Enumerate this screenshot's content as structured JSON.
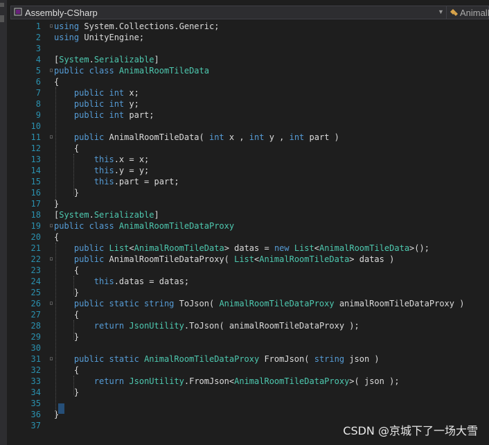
{
  "toolbar": {
    "project": "Assembly-CSharp",
    "member": "AnimalR"
  },
  "watermark": "CSDN @京城下了一场大雪",
  "lines": [
    [
      [
        "kw",
        "using"
      ],
      [
        "pl",
        " System.Collections.Generic;"
      ]
    ],
    [
      [
        "kw",
        "using"
      ],
      [
        "pl",
        " UnityEngine;"
      ]
    ],
    [],
    [
      [
        "pl",
        "["
      ],
      [
        "ty",
        "System"
      ],
      [
        "pl",
        "."
      ],
      [
        "ty",
        "Serializable"
      ],
      [
        "pl",
        "]"
      ]
    ],
    [
      [
        "kw",
        "public class "
      ],
      [
        "ty",
        "AnimalRoomTileData"
      ]
    ],
    [
      [
        "pl",
        "{"
      ]
    ],
    [
      [
        "pl",
        "    "
      ],
      [
        "kw",
        "public int"
      ],
      [
        "pl",
        " x;"
      ]
    ],
    [
      [
        "pl",
        "    "
      ],
      [
        "kw",
        "public int"
      ],
      [
        "pl",
        " y;"
      ]
    ],
    [
      [
        "pl",
        "    "
      ],
      [
        "kw",
        "public int"
      ],
      [
        "pl",
        " part;"
      ]
    ],
    [],
    [
      [
        "pl",
        "    "
      ],
      [
        "kw",
        "public"
      ],
      [
        "pl",
        " AnimalRoomTileData( "
      ],
      [
        "kw",
        "int"
      ],
      [
        "pl",
        " x , "
      ],
      [
        "kw",
        "int"
      ],
      [
        "pl",
        " y , "
      ],
      [
        "kw",
        "int"
      ],
      [
        "pl",
        " part )"
      ]
    ],
    [
      [
        "pl",
        "    {"
      ]
    ],
    [
      [
        "pl",
        "        "
      ],
      [
        "kw",
        "this"
      ],
      [
        "pl",
        ".x = x;"
      ]
    ],
    [
      [
        "pl",
        "        "
      ],
      [
        "kw",
        "this"
      ],
      [
        "pl",
        ".y = y;"
      ]
    ],
    [
      [
        "pl",
        "        "
      ],
      [
        "kw",
        "this"
      ],
      [
        "pl",
        ".part = part;"
      ]
    ],
    [
      [
        "pl",
        "    }"
      ]
    ],
    [
      [
        "pl",
        "}"
      ]
    ],
    [
      [
        "pl",
        "["
      ],
      [
        "ty",
        "System"
      ],
      [
        "pl",
        "."
      ],
      [
        "ty",
        "Serializable"
      ],
      [
        "pl",
        "]"
      ]
    ],
    [
      [
        "kw",
        "public class "
      ],
      [
        "ty",
        "AnimalRoomTileDataProxy"
      ]
    ],
    [
      [
        "pl",
        "{"
      ]
    ],
    [
      [
        "pl",
        "    "
      ],
      [
        "kw",
        "public"
      ],
      [
        "pl",
        " "
      ],
      [
        "ty",
        "List"
      ],
      [
        "pl",
        "<"
      ],
      [
        "ty",
        "AnimalRoomTileData"
      ],
      [
        "pl",
        "> datas = "
      ],
      [
        "kw",
        "new"
      ],
      [
        "pl",
        " "
      ],
      [
        "ty",
        "List"
      ],
      [
        "pl",
        "<"
      ],
      [
        "ty",
        "AnimalRoomTileData"
      ],
      [
        "pl",
        ">();"
      ]
    ],
    [
      [
        "pl",
        "    "
      ],
      [
        "kw",
        "public"
      ],
      [
        "pl",
        " AnimalRoomTileDataProxy( "
      ],
      [
        "ty",
        "List"
      ],
      [
        "pl",
        "<"
      ],
      [
        "ty",
        "AnimalRoomTileData"
      ],
      [
        "pl",
        "> datas )"
      ]
    ],
    [
      [
        "pl",
        "    {"
      ]
    ],
    [
      [
        "pl",
        "        "
      ],
      [
        "kw",
        "this"
      ],
      [
        "pl",
        ".datas = datas;"
      ]
    ],
    [
      [
        "pl",
        "    }"
      ]
    ],
    [
      [
        "pl",
        "    "
      ],
      [
        "kw",
        "public static string"
      ],
      [
        "pl",
        " ToJson( "
      ],
      [
        "ty",
        "AnimalRoomTileDataProxy"
      ],
      [
        "pl",
        " animalRoomTileDataProxy )"
      ]
    ],
    [
      [
        "pl",
        "    {"
      ]
    ],
    [
      [
        "pl",
        "        "
      ],
      [
        "kw",
        "return"
      ],
      [
        "pl",
        " "
      ],
      [
        "ty",
        "JsonUtility"
      ],
      [
        "pl",
        ".ToJson( animalRoomTileDataProxy );"
      ]
    ],
    [
      [
        "pl",
        "    }"
      ]
    ],
    [],
    [
      [
        "pl",
        "    "
      ],
      [
        "kw",
        "public static"
      ],
      [
        "pl",
        " "
      ],
      [
        "ty",
        "AnimalRoomTileDataProxy"
      ],
      [
        "pl",
        " FromJson( "
      ],
      [
        "kw",
        "string"
      ],
      [
        "pl",
        " json )"
      ]
    ],
    [
      [
        "pl",
        "    {"
      ]
    ],
    [
      [
        "pl",
        "        "
      ],
      [
        "kw",
        "return"
      ],
      [
        "pl",
        " "
      ],
      [
        "ty",
        "JsonUtility"
      ],
      [
        "pl",
        ".FromJson<"
      ],
      [
        "ty",
        "AnimalRoomTileDataProxy"
      ],
      [
        "pl",
        ">( json );"
      ]
    ],
    [
      [
        "pl",
        "    }"
      ]
    ],
    [],
    [
      [
        "pl",
        "}"
      ]
    ],
    []
  ]
}
